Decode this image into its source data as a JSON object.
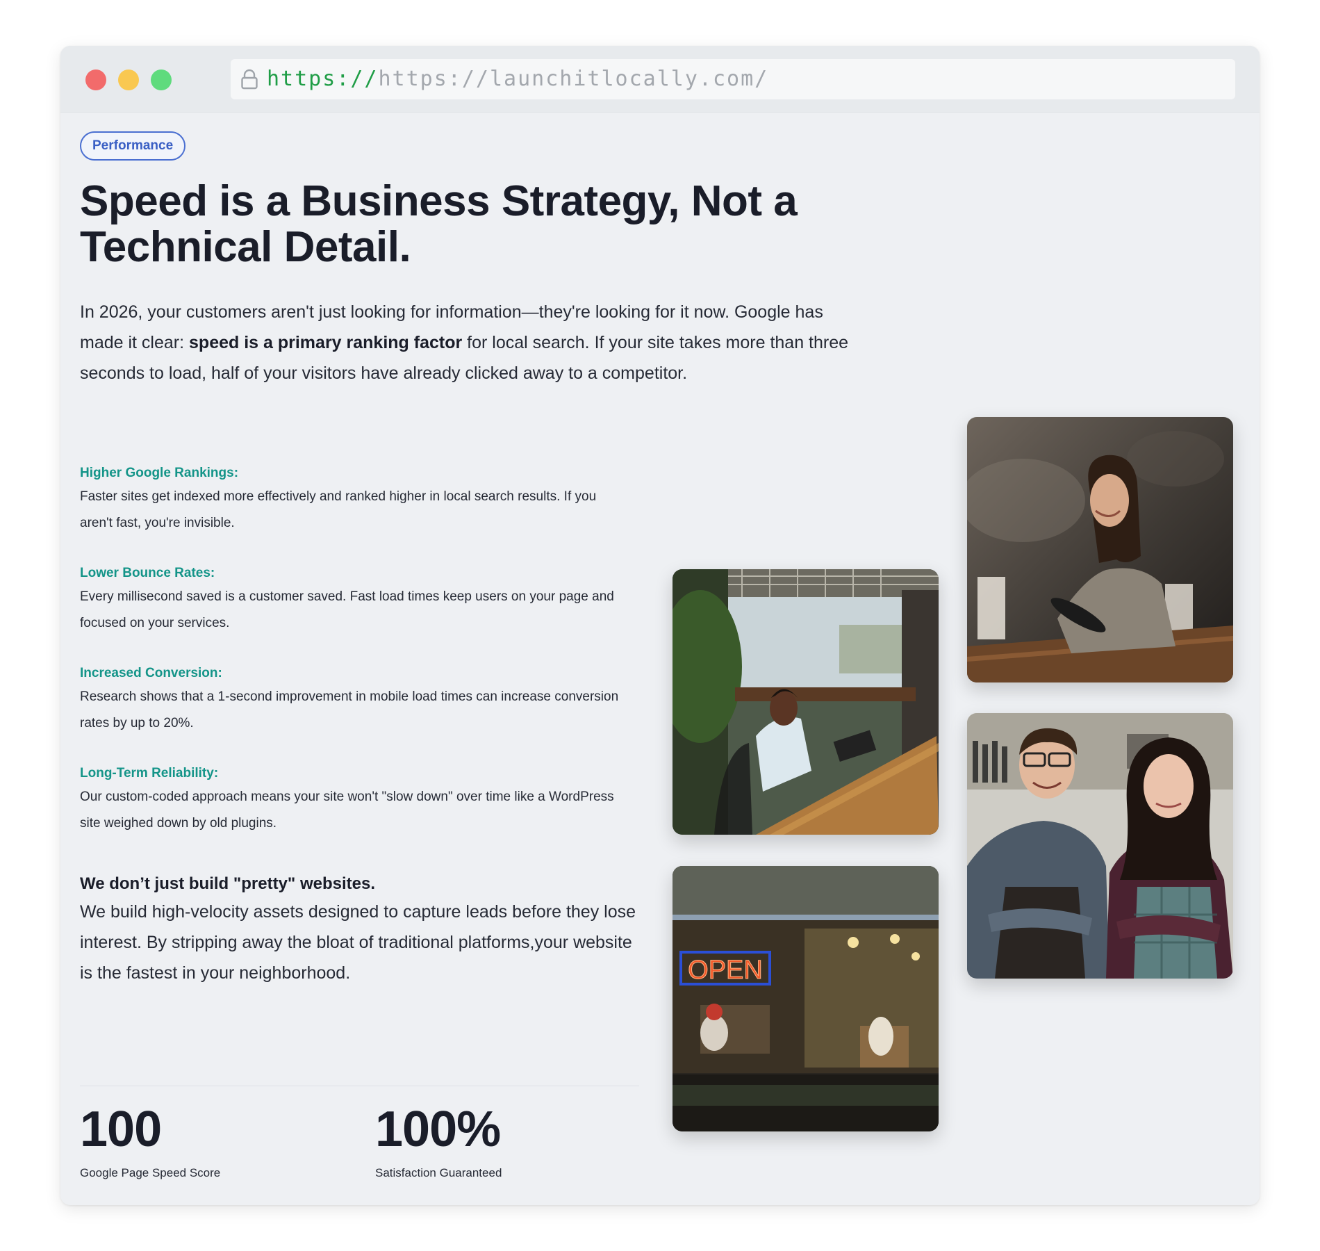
{
  "browser": {
    "url_scheme": "https://",
    "url_host": "https://launchitlocally.com/",
    "icons": [
      "close-dot",
      "minimize-dot",
      "maximize-dot",
      "lock-icon"
    ]
  },
  "badge": "Performance",
  "headline": "Speed is a Business Strategy, Not a Technical Detail.",
  "intro": {
    "part1": "In 2026, your customers aren't just looking for information—they're looking for it now. Google has made it clear: ",
    "bold": "speed is a primary ranking factor",
    "part2": " for local search. If your site takes more than three seconds to load, half of your visitors have already clicked away to a competitor."
  },
  "features": [
    {
      "title": "Higher Google Rankings:",
      "body": "Faster sites get indexed more effectively and ranked higher in local search results. If you aren't fast, you're invisible."
    },
    {
      "title": "Lower Bounce Rates:",
      "body": "Every millisecond saved is a customer saved. Fast load times keep users on your page and focused on your services."
    },
    {
      "title": "Increased Conversion:",
      "body": "Research shows that a 1-second improvement in mobile load times can increase conversion rates by up to 20%."
    },
    {
      "title": "Long-Term Reliability:",
      "body": "Our custom-coded approach means your site won't \"slow down\" over time like a WordPress site weighed down by old plugins."
    }
  ],
  "pitch": {
    "title": "We don’t just build \"pretty\" websites.",
    "body": "We build high-velocity assets designed to capture leads before they lose interest. By stripping away the bloat of traditional platforms,your website is the fastest in your neighborhood."
  },
  "stats": [
    {
      "value": "100",
      "label": "Google Page Speed Score"
    },
    {
      "value": "100%",
      "label": "Satisfaction Guaranteed"
    }
  ],
  "photos": {
    "neon_sign_text": "OPEN"
  },
  "colors": {
    "accent_teal": "#139488",
    "badge_blue": "#3a5fc4",
    "url_green": "#1f9d46",
    "window_bg": "#eef0f3"
  }
}
